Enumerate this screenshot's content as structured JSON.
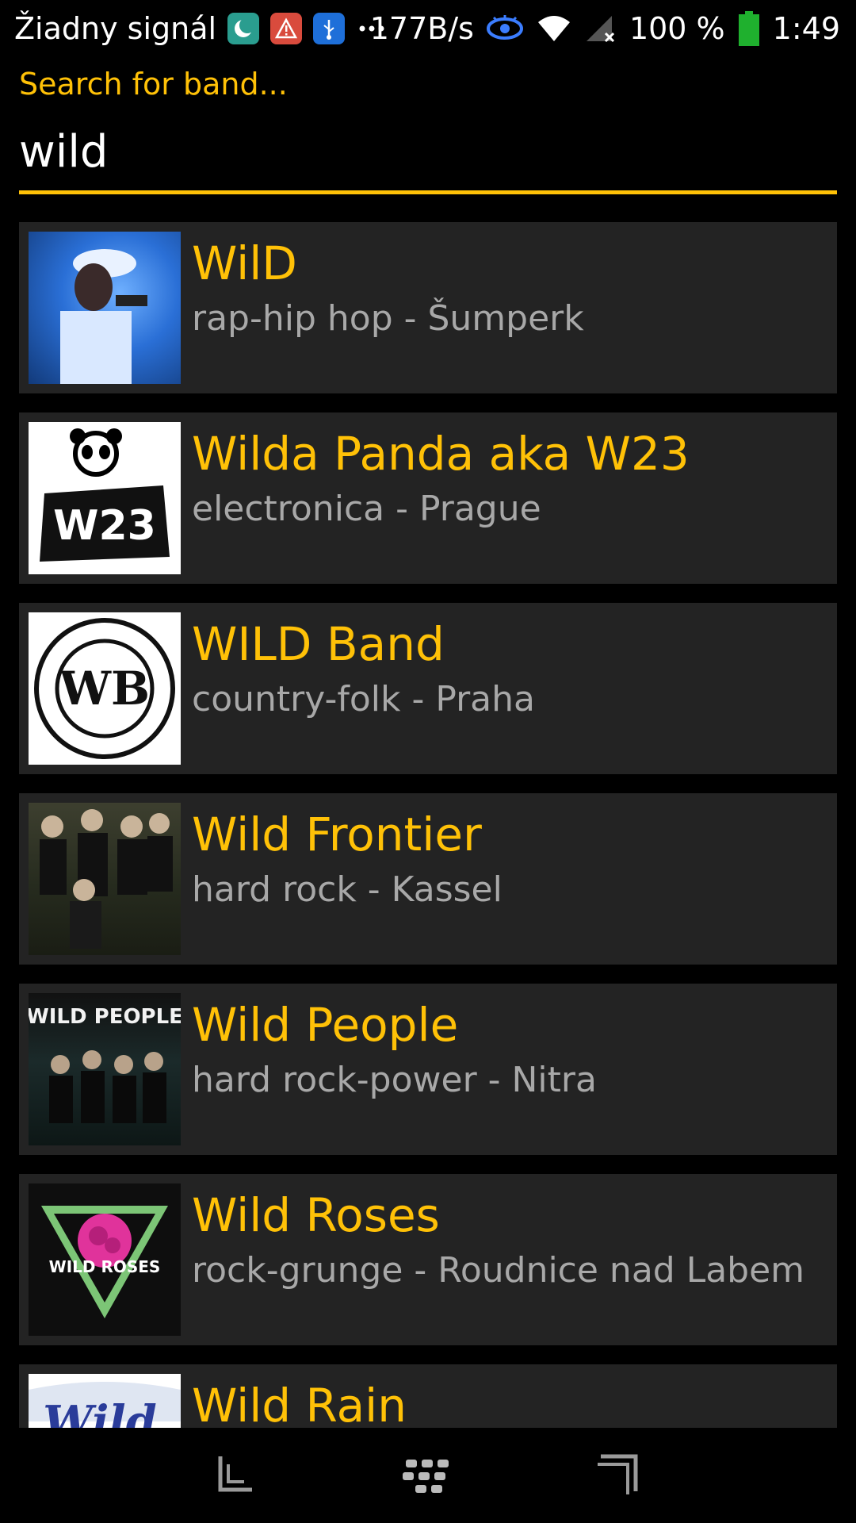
{
  "status_bar": {
    "carrier": "Žiadny signál",
    "network_speed": "177B/s",
    "battery_percent": "100 %",
    "time": "1:49",
    "icons": [
      "moon-icon",
      "warning-icon",
      "usb-icon",
      "more-icon",
      "eye-icon",
      "wifi-icon",
      "no-signal-icon",
      "battery-icon"
    ]
  },
  "search": {
    "label": "Search for band...",
    "value": "wild"
  },
  "results": [
    {
      "name": "WilD",
      "meta": "rap-hip hop - Šumperk"
    },
    {
      "name": "Wilda Panda aka W23",
      "meta": "electronica - Prague"
    },
    {
      "name": "WILD Band",
      "meta": "country-folk - Praha"
    },
    {
      "name": "Wild Frontier",
      "meta": "hard rock - Kassel"
    },
    {
      "name": "Wild People",
      "meta": "hard rock-power - Nitra"
    },
    {
      "name": "Wild Roses",
      "meta": "rock-grunge - Roudnice nad Labem"
    },
    {
      "name": "Wild Rain",
      "meta": ""
    }
  ],
  "thumb_text": {
    "w23": "W23",
    "wb": "WB",
    "wild_people": "WILD PEOPLE",
    "wild_roses": "WILD ROSES",
    "wild_rain": "Wild"
  },
  "nav": {
    "icons": [
      "back-icon",
      "blackberry-logo-icon",
      "recent-apps-icon"
    ]
  },
  "colors": {
    "accent": "#ffc107",
    "row_background": "#232323",
    "secondary_text": "#a8a8a8"
  }
}
